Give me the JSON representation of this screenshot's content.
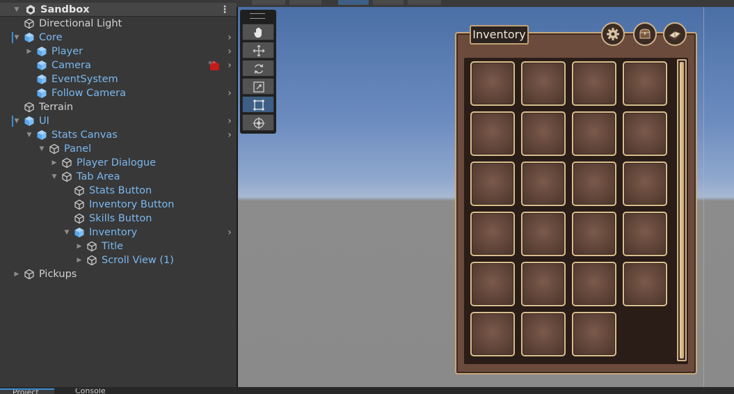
{
  "hierarchy": {
    "scene_name": "Sandbox",
    "items": [
      {
        "label": "Directional Light",
        "depth": 1,
        "arrow": "",
        "blue": false,
        "prefab": false,
        "has_more": false
      },
      {
        "label": "Core",
        "depth": 1,
        "arrow": "down",
        "blue": true,
        "prefab": true,
        "has_more": true,
        "mark": true
      },
      {
        "label": "Player",
        "depth": 2,
        "arrow": "right",
        "blue": true,
        "prefab": true,
        "has_more": true
      },
      {
        "label": "Camera",
        "depth": 2,
        "arrow": "",
        "blue": true,
        "prefab": true,
        "has_more": true,
        "warn": true
      },
      {
        "label": "EventSystem",
        "depth": 2,
        "arrow": "",
        "blue": true,
        "prefab": true,
        "has_more": false
      },
      {
        "label": "Follow Camera",
        "depth": 2,
        "arrow": "",
        "blue": true,
        "prefab": true,
        "has_more": true
      },
      {
        "label": "Terrain",
        "depth": 1,
        "arrow": "",
        "blue": false,
        "prefab": false,
        "has_more": false
      },
      {
        "label": "UI",
        "depth": 1,
        "arrow": "down",
        "blue": true,
        "prefab": true,
        "has_more": true,
        "mark": true
      },
      {
        "label": "Stats Canvas",
        "depth": 2,
        "arrow": "down",
        "blue": true,
        "prefab": true,
        "has_more": true
      },
      {
        "label": "Panel",
        "depth": 3,
        "arrow": "down",
        "blue": true,
        "prefab": false,
        "has_more": false
      },
      {
        "label": "Player Dialogue",
        "depth": 4,
        "arrow": "right",
        "blue": true,
        "prefab": false,
        "has_more": false
      },
      {
        "label": "Tab Area",
        "depth": 4,
        "arrow": "down",
        "blue": true,
        "prefab": false,
        "has_more": false
      },
      {
        "label": "Stats Button",
        "depth": 5,
        "arrow": "",
        "blue": true,
        "prefab": false,
        "has_more": false
      },
      {
        "label": "Inventory Button",
        "depth": 5,
        "arrow": "",
        "blue": true,
        "prefab": false,
        "has_more": false
      },
      {
        "label": "Skills Button",
        "depth": 5,
        "arrow": "",
        "blue": true,
        "prefab": false,
        "has_more": false
      },
      {
        "label": "Inventory",
        "depth": 5,
        "arrow": "down",
        "blue": true,
        "prefab": true,
        "has_more": true
      },
      {
        "label": "Title",
        "depth": 6,
        "arrow": "right",
        "blue": true,
        "prefab": false,
        "has_more": false
      },
      {
        "label": "Scroll View (1)",
        "depth": 6,
        "arrow": "right",
        "blue": true,
        "prefab": false,
        "has_more": false
      },
      {
        "label": "Pickups",
        "depth": 1,
        "arrow": "right",
        "blue": false,
        "prefab": false,
        "has_more": false
      }
    ]
  },
  "tools": [
    {
      "name": "hand-tool",
      "active": false
    },
    {
      "name": "move-tool",
      "active": false
    },
    {
      "name": "rotate-tool",
      "active": false
    },
    {
      "name": "scale-tool",
      "active": false
    },
    {
      "name": "rect-tool",
      "active": true
    },
    {
      "name": "transform-tool",
      "active": false
    }
  ],
  "inventory": {
    "title": "Inventory",
    "buttons": [
      "gear-icon",
      "chest-icon",
      "book-icon"
    ],
    "slot_rows": [
      4,
      4,
      4,
      4,
      4,
      3
    ]
  },
  "bottom_tabs": [
    "Project",
    "Console"
  ],
  "colors": {
    "prefab_blue": "#7bb8ee",
    "panel_bg": "#383838",
    "inventory_frame": "#c8a97c",
    "selected_tool": "#3d5f86"
  }
}
